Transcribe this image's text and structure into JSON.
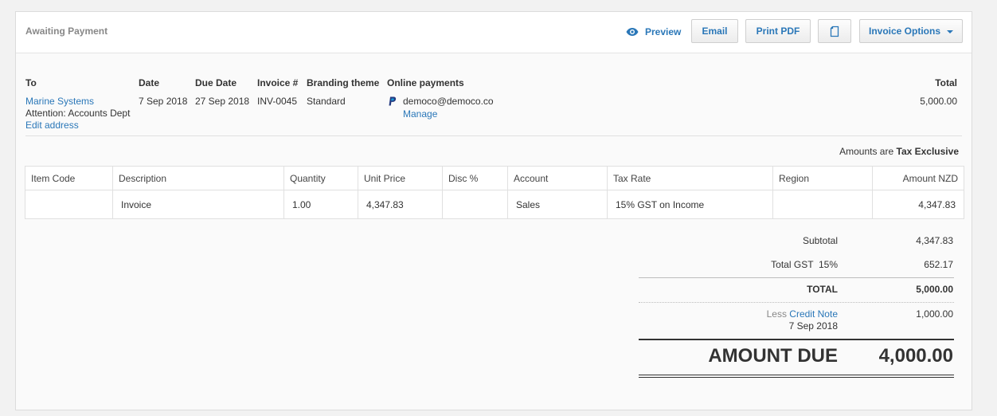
{
  "header": {
    "status": "Awaiting Payment",
    "preview_label": "Preview",
    "email_label": "Email",
    "print_label": "Print PDF",
    "options_label": "Invoice Options"
  },
  "info": {
    "to_label": "To",
    "to_name": "Marine Systems",
    "to_attention": "Attention: Accounts Dept",
    "edit_address": "Edit address",
    "date_label": "Date",
    "date_value": "7 Sep 2018",
    "due_label": "Due Date",
    "due_value": "27 Sep 2018",
    "invoice_label": "Invoice #",
    "invoice_value": "INV-0045",
    "branding_label": "Branding theme",
    "branding_value": "Standard",
    "online_label": "Online payments",
    "online_email": "democo@democo.co",
    "manage": "Manage",
    "total_label": "Total",
    "total_value": "5,000.00"
  },
  "tax_note": {
    "prefix": "Amounts are",
    "mode": "Tax Exclusive"
  },
  "table": {
    "columns": [
      "Item Code",
      "Description",
      "Quantity",
      "Unit Price",
      "Disc %",
      "Account",
      "Tax Rate",
      "Region",
      "Amount NZD"
    ],
    "rows": [
      [
        "",
        "Invoice",
        "1.00",
        "4,347.83",
        "",
        "Sales",
        "15% GST on Income",
        "",
        "4,347.83"
      ]
    ]
  },
  "totals": {
    "subtotal_label": "Subtotal",
    "subtotal_value": "4,347.83",
    "gst_label": "Total GST  15%",
    "gst_value": "652.17",
    "total_label": "TOTAL",
    "total_value": "5,000.00",
    "less_label": "Less",
    "credit_note_label": "Credit Note",
    "credit_note_date": "7 Sep 2018",
    "credit_value": "1,000.00",
    "amount_due_label": "AMOUNT DUE",
    "amount_due_value": "4,000.00"
  },
  "colors": {
    "accent": "#2a77b8",
    "paypal": "#253b80"
  }
}
